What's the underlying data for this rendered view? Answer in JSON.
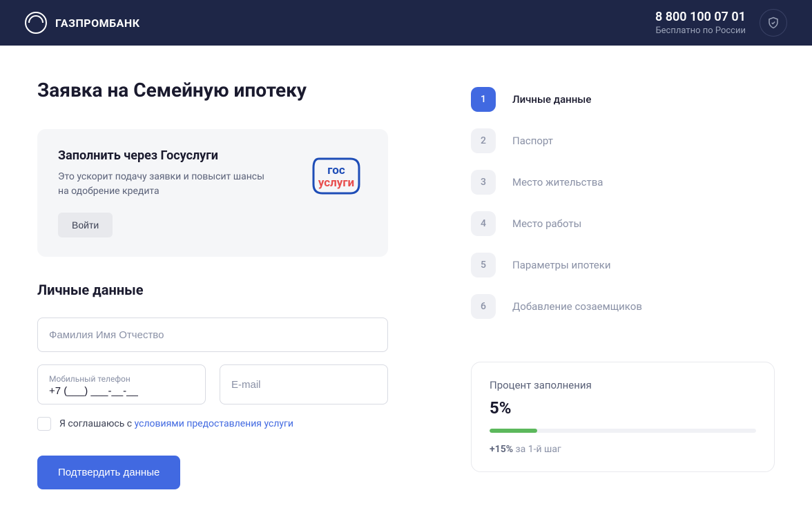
{
  "header": {
    "brand": "ГАЗПРОМБАНК",
    "phone": "8 800 100 07 01",
    "phone_sub": "Бесплатно по России"
  },
  "page_title": "Заявка на Семейную ипотеку",
  "gosuslugi": {
    "title": "Заполнить через Госуслуги",
    "desc": "Это ускорит подачу заявки и повысит шансы на одобрение кредита",
    "login_btn": "Войти",
    "logo_top": "гос",
    "logo_bottom": "услуги"
  },
  "section_title": "Личные данные",
  "form": {
    "fio_placeholder": "Фамилия Имя Отчество",
    "phone_label": "Мобильный телефон",
    "phone_value": "+7 (___) ___-__-__",
    "email_placeholder": "E-mail",
    "consent_prefix": "Я соглашаюсь с ",
    "consent_link": "условиями предоставления услуги",
    "submit": "Подтвердить данные"
  },
  "steps": [
    {
      "num": "1",
      "label": "Личные данные",
      "active": true
    },
    {
      "num": "2",
      "label": "Паспорт",
      "active": false
    },
    {
      "num": "3",
      "label": "Место жительства",
      "active": false
    },
    {
      "num": "4",
      "label": "Место работы",
      "active": false
    },
    {
      "num": "5",
      "label": "Параметры ипотеки",
      "active": false
    },
    {
      "num": "6",
      "label": "Добавление созаемщиков",
      "active": false
    }
  ],
  "progress": {
    "title": "Процент заполнения",
    "value": "5%",
    "fill_percent": 18,
    "hint_bold": "+15%",
    "hint_rest": " за 1-й шаг"
  }
}
